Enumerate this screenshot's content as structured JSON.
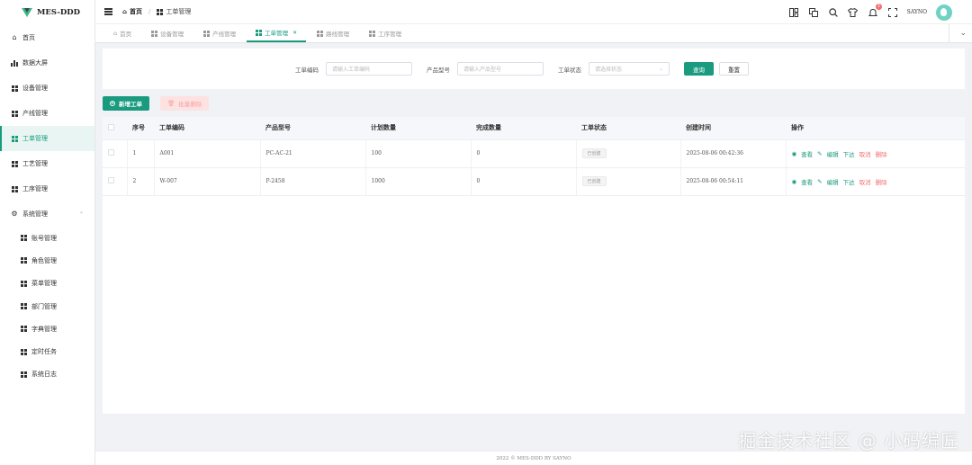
{
  "app": {
    "title": "MES-DDD"
  },
  "sidebar": {
    "items": [
      {
        "label": "首页",
        "icon": "home-icon"
      },
      {
        "label": "数据大屏",
        "icon": "bar-chart-icon"
      },
      {
        "label": "设备管理",
        "icon": "grid-icon"
      },
      {
        "label": "产线管理",
        "icon": "grid-icon"
      },
      {
        "label": "工单管理",
        "icon": "grid-icon",
        "active": true
      },
      {
        "label": "工艺管理",
        "icon": "grid-icon"
      },
      {
        "label": "工序管理",
        "icon": "grid-icon"
      },
      {
        "label": "系统管理",
        "icon": "gear-icon",
        "expanded": true
      }
    ],
    "subitems": [
      {
        "label": "账号管理"
      },
      {
        "label": "角色管理"
      },
      {
        "label": "菜单管理"
      },
      {
        "label": "部门管理"
      },
      {
        "label": "字典管理"
      },
      {
        "label": "定时任务"
      },
      {
        "label": "系统日志"
      }
    ]
  },
  "header": {
    "breadcrumb": {
      "home": "首页",
      "current": "工单管理"
    },
    "username": "SAYNO",
    "notification_count": "3"
  },
  "tabs": [
    {
      "label": "首页",
      "icon": "home-icon"
    },
    {
      "label": "设备管理",
      "icon": "grid-icon"
    },
    {
      "label": "产线管理",
      "icon": "grid-icon"
    },
    {
      "label": "工单管理",
      "icon": "grid-icon",
      "active": true
    },
    {
      "label": "路线管理",
      "icon": "grid-icon"
    },
    {
      "label": "工序管理",
      "icon": "grid-icon"
    }
  ],
  "search": {
    "order_code_label": "工单编码",
    "order_code_placeholder": "请输入工单编码",
    "model_label": "产品型号",
    "model_placeholder": "请输入产品型号",
    "status_label": "工单状态",
    "status_placeholder": "请选择状态",
    "query_button": "查询",
    "reset_button": "重置"
  },
  "toolbar": {
    "add_button": "新增工单",
    "batch_delete_button": "批量删除"
  },
  "table": {
    "columns": [
      "序号",
      "工单编码",
      "产品型号",
      "计划数量",
      "完成数量",
      "工单状态",
      "创建时间",
      "操作"
    ],
    "rows": [
      {
        "index": "1",
        "code": "A001",
        "model": "PC-AC-21",
        "planned": "100",
        "completed": "0",
        "status": "已创建",
        "created": "2025-08-06 00:42:36"
      },
      {
        "index": "2",
        "code": "W-007",
        "model": "P-2458",
        "planned": "1000",
        "completed": "0",
        "status": "已创建",
        "created": "2025-08-06 00:54:11"
      }
    ],
    "ops": {
      "view": "查看",
      "edit": "编辑",
      "dispatch": "下达",
      "cancel": "取消",
      "delete": "删除"
    }
  },
  "footer": {
    "text": "2022 © MES-DDD BY SAYNO"
  },
  "watermark": {
    "text": "掘金技术社区 @ 小码编匠"
  },
  "colors": {
    "primary": "#1a9a7f",
    "danger": "#f56c6c"
  }
}
